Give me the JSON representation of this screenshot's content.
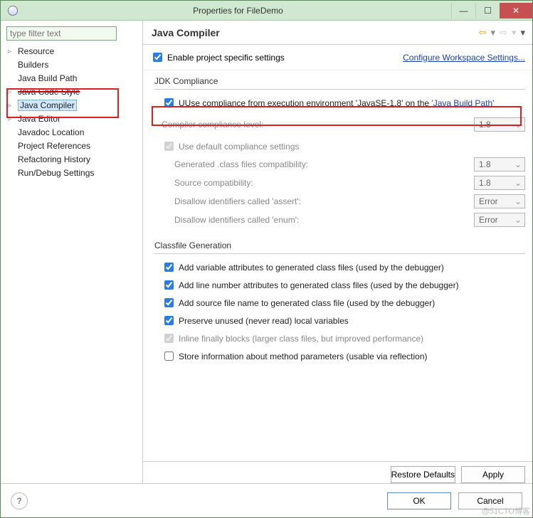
{
  "window": {
    "title": "Properties for FileDemo"
  },
  "sidebar": {
    "filter_placeholder": "type filter text",
    "items": [
      {
        "label": "Resource",
        "children": true
      },
      {
        "label": "Builders"
      },
      {
        "label": "Java Build Path"
      },
      {
        "label": "Java Code Style",
        "children": true,
        "strike": true
      },
      {
        "label": "Java Compiler",
        "children": true,
        "selected": true
      },
      {
        "label": "Java Editor",
        "children": true
      },
      {
        "label": "Javadoc Location"
      },
      {
        "label": "Project References"
      },
      {
        "label": "Refactoring History"
      },
      {
        "label": "Run/Debug Settings"
      }
    ]
  },
  "main": {
    "title": "Java Compiler",
    "enable_label": "Enable project specific settings",
    "configure_link": "Configure Workspace Settings..."
  },
  "jdk": {
    "section_title": "JDK Compliance",
    "use_exec_env": "Use compliance from execution environment 'JavaSE-1.8' on the ",
    "build_path_link": "'Java Build Path'",
    "compliance_label": "Compiler compliance level:",
    "compliance_value": "1.8",
    "use_default_label": "Use default compliance settings",
    "rows": [
      {
        "label": "Generated .class files compatibility:",
        "value": "1.8"
      },
      {
        "label": "Source compatibility:",
        "value": "1.8"
      },
      {
        "label": "Disallow identifiers called 'assert':",
        "value": "Error"
      },
      {
        "label": "Disallow identifiers called 'enum':",
        "value": "Error"
      }
    ]
  },
  "classfile": {
    "section_title": "Classfile Generation",
    "items": [
      {
        "checked": true,
        "enabled": true,
        "label": "Add variable attributes to generated class files (used by the debugger)"
      },
      {
        "checked": true,
        "enabled": true,
        "label": "Add line number attributes to generated class files (used by the debugger)"
      },
      {
        "checked": true,
        "enabled": true,
        "label": "Add source file name to generated class file (used by the debugger)"
      },
      {
        "checked": true,
        "enabled": true,
        "label": "Preserve unused (never read) local variables"
      },
      {
        "checked": true,
        "enabled": false,
        "label": "Inline finally blocks (larger class files, but improved performance)"
      },
      {
        "checked": false,
        "enabled": true,
        "label": "Store information about method parameters (usable via reflection)"
      }
    ]
  },
  "buttons": {
    "restore": "Restore Defaults",
    "apply": "Apply",
    "ok": "OK",
    "cancel": "Cancel"
  },
  "watermark": "@51CTO博客"
}
